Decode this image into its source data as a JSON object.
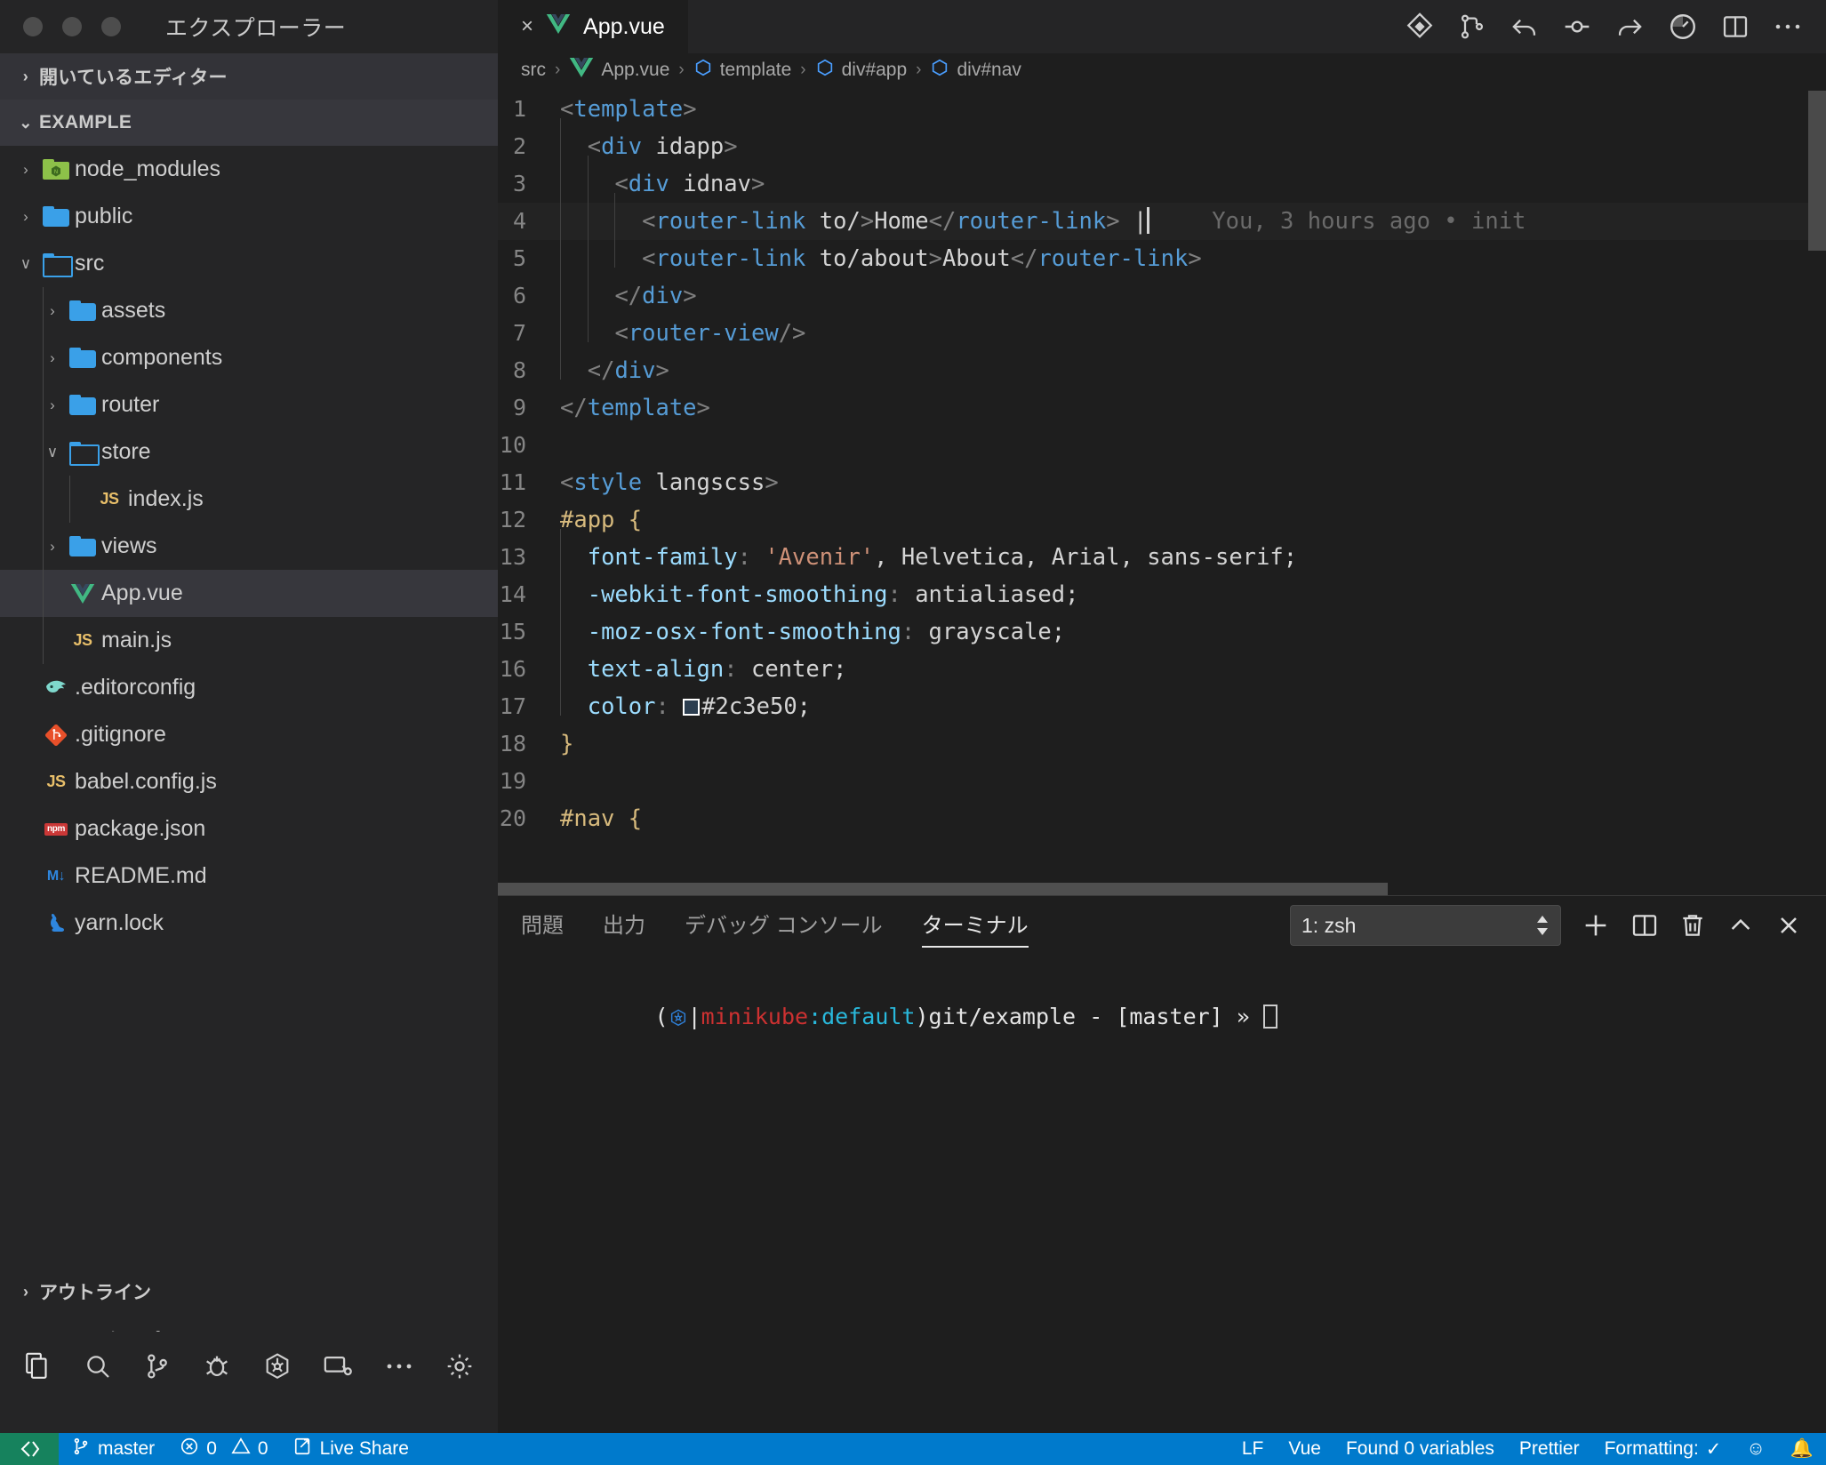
{
  "window": {
    "sidebar_title": "エクスプローラー"
  },
  "sidebar": {
    "open_editors_label": "開いているエディター",
    "workspace_label": "EXAMPLE",
    "tree": [
      {
        "label": "node_modules",
        "icon": "folder-node-icon",
        "depth": 1,
        "twisty": "›",
        "kind": "folder"
      },
      {
        "label": "public",
        "icon": "folder-icon",
        "depth": 1,
        "twisty": "›",
        "kind": "folder"
      },
      {
        "label": "src",
        "icon": "folder-open-icon",
        "depth": 1,
        "twisty": "∨",
        "kind": "folder"
      },
      {
        "label": "assets",
        "icon": "folder-icon",
        "depth": 2,
        "twisty": "›",
        "kind": "folder"
      },
      {
        "label": "components",
        "icon": "folder-icon",
        "depth": 2,
        "twisty": "›",
        "kind": "folder"
      },
      {
        "label": "router",
        "icon": "folder-icon",
        "depth": 2,
        "twisty": "›",
        "kind": "folder"
      },
      {
        "label": "store",
        "icon": "folder-open-icon",
        "depth": 2,
        "twisty": "∨",
        "kind": "folder"
      },
      {
        "label": "index.js",
        "icon": "js-icon",
        "depth": 3,
        "twisty": "",
        "kind": "file"
      },
      {
        "label": "views",
        "icon": "folder-icon",
        "depth": 2,
        "twisty": "›",
        "kind": "folder"
      },
      {
        "label": "App.vue",
        "icon": "vue-icon",
        "depth": 2,
        "twisty": "",
        "kind": "file",
        "selected": true
      },
      {
        "label": "main.js",
        "icon": "js-icon",
        "depth": 2,
        "twisty": "",
        "kind": "file"
      },
      {
        "label": ".editorconfig",
        "icon": "editorconfig-icon",
        "depth": 1,
        "twisty": "",
        "kind": "file"
      },
      {
        "label": ".gitignore",
        "icon": "git-icon",
        "depth": 1,
        "twisty": "",
        "kind": "file"
      },
      {
        "label": "babel.config.js",
        "icon": "js-icon",
        "depth": 1,
        "twisty": "",
        "kind": "file"
      },
      {
        "label": "package.json",
        "icon": "npm-icon",
        "depth": 1,
        "twisty": "",
        "kind": "file"
      },
      {
        "label": "README.md",
        "icon": "markdown-icon",
        "depth": 1,
        "twisty": "",
        "kind": "file"
      },
      {
        "label": "yarn.lock",
        "icon": "yarn-icon",
        "depth": 1,
        "twisty": "",
        "kind": "file"
      }
    ],
    "bottom_panels": [
      {
        "label": "アウトライン",
        "twisty": "›"
      },
      {
        "label": "NPM スクリプト",
        "twisty": "›"
      }
    ],
    "activity_icons": [
      "files-explorer-icon",
      "search-icon",
      "source-control-icon",
      "debug-icon",
      "kubernetes-icon",
      "remote-explorer-icon",
      "more-icon",
      "settings-gear-icon"
    ]
  },
  "editor": {
    "tab": {
      "label": "App.vue",
      "icon": "vue-icon",
      "close": "×"
    },
    "tab_actions": [
      "source-control-icon",
      "split-compare-icon",
      "step-back-icon",
      "circle-icon",
      "step-forward-icon",
      "timer-icon",
      "split-editor-icon",
      "more-actions-icon"
    ],
    "breadcrumbs": [
      {
        "label": "src",
        "icon": ""
      },
      {
        "label": "App.vue",
        "icon": "vue-icon"
      },
      {
        "label": "template",
        "icon": "symbol-cube-icon"
      },
      {
        "label": "div#app",
        "icon": "symbol-cube-icon"
      },
      {
        "label": "div#nav",
        "icon": "symbol-cube-icon"
      }
    ],
    "blame_annotation": "You, 3 hours ago • init",
    "color_swatch": "#2c3e50",
    "lines": [
      {
        "n": 1,
        "indent": 0
      },
      {
        "n": 2,
        "indent": 1
      },
      {
        "n": 3,
        "indent": 2
      },
      {
        "n": 4,
        "indent": 3
      },
      {
        "n": 5,
        "indent": 3
      },
      {
        "n": 6,
        "indent": 2
      },
      {
        "n": 7,
        "indent": 2
      },
      {
        "n": 8,
        "indent": 1
      },
      {
        "n": 9,
        "indent": 0
      },
      {
        "n": 10,
        "indent": 0
      },
      {
        "n": 11,
        "indent": 0
      },
      {
        "n": 12,
        "indent": 0
      },
      {
        "n": 13,
        "indent": 1
      },
      {
        "n": 14,
        "indent": 1
      },
      {
        "n": 15,
        "indent": 1
      },
      {
        "n": 16,
        "indent": 1
      },
      {
        "n": 17,
        "indent": 1
      },
      {
        "n": 18,
        "indent": 0
      },
      {
        "n": 19,
        "indent": 0
      },
      {
        "n": 20,
        "indent": 0
      }
    ],
    "source_text": [
      "<template>",
      "  <div id=\"app\">",
      "    <div id=\"nav\">",
      "      <router-link to=\"/\">Home</router-link> |",
      "      <router-link to=\"/about\">About</router-link>",
      "    </div>",
      "    <router-view/>",
      "  </div>",
      "</template>",
      "",
      "<style lang=\"scss\">",
      "#app {",
      "  font-family: 'Avenir', Helvetica, Arial, sans-serif;",
      "  -webkit-font-smoothing: antialiased;",
      "  -moz-osx-font-smoothing: grayscale;",
      "  text-align: center;",
      "  color: #2c3e50;",
      "}",
      "",
      "#nav {"
    ]
  },
  "panel": {
    "tabs": [
      {
        "label": "問題",
        "active": false
      },
      {
        "label": "出力",
        "active": false
      },
      {
        "label": "デバッグ コンソール",
        "active": false
      },
      {
        "label": "ターミナル",
        "active": true
      }
    ],
    "terminal_select_value": "1: zsh",
    "actions": [
      "add-terminal-icon",
      "split-terminal-icon",
      "kill-terminal-icon",
      "maximize-panel-icon",
      "close-panel-icon"
    ],
    "prompt": {
      "paren_open": "(",
      "kube_icon": "kubernetes-icon",
      "pipe": "|",
      "context": "minikube",
      "colon": ":",
      "namespace": "default",
      "paren_close": ")",
      "path": "git/example",
      "dash": "-",
      "branch": "[master]",
      "sigil": "»"
    }
  },
  "statusbar": {
    "remote_icon": "remote-host-icon",
    "items": [
      {
        "name": "branch",
        "icon": "source-control-icon",
        "label": "master"
      },
      {
        "name": "problems",
        "icon": "error-warning-icon",
        "label": "0  0",
        "errors": "0",
        "warnings": "0"
      },
      {
        "name": "live-share",
        "icon": "live-share-icon",
        "label": "Live Share"
      }
    ],
    "right_items": [
      {
        "name": "eol",
        "label": "LF"
      },
      {
        "name": "language-mode",
        "label": "Vue"
      },
      {
        "name": "found-variables",
        "label": "Found 0 variables"
      },
      {
        "name": "prettier",
        "label": "Prettier"
      },
      {
        "name": "formatting",
        "label": "Formatting:",
        "check": "✓"
      },
      {
        "name": "feedback",
        "label": "☺"
      },
      {
        "name": "notifications",
        "label": "🔔"
      }
    ]
  }
}
